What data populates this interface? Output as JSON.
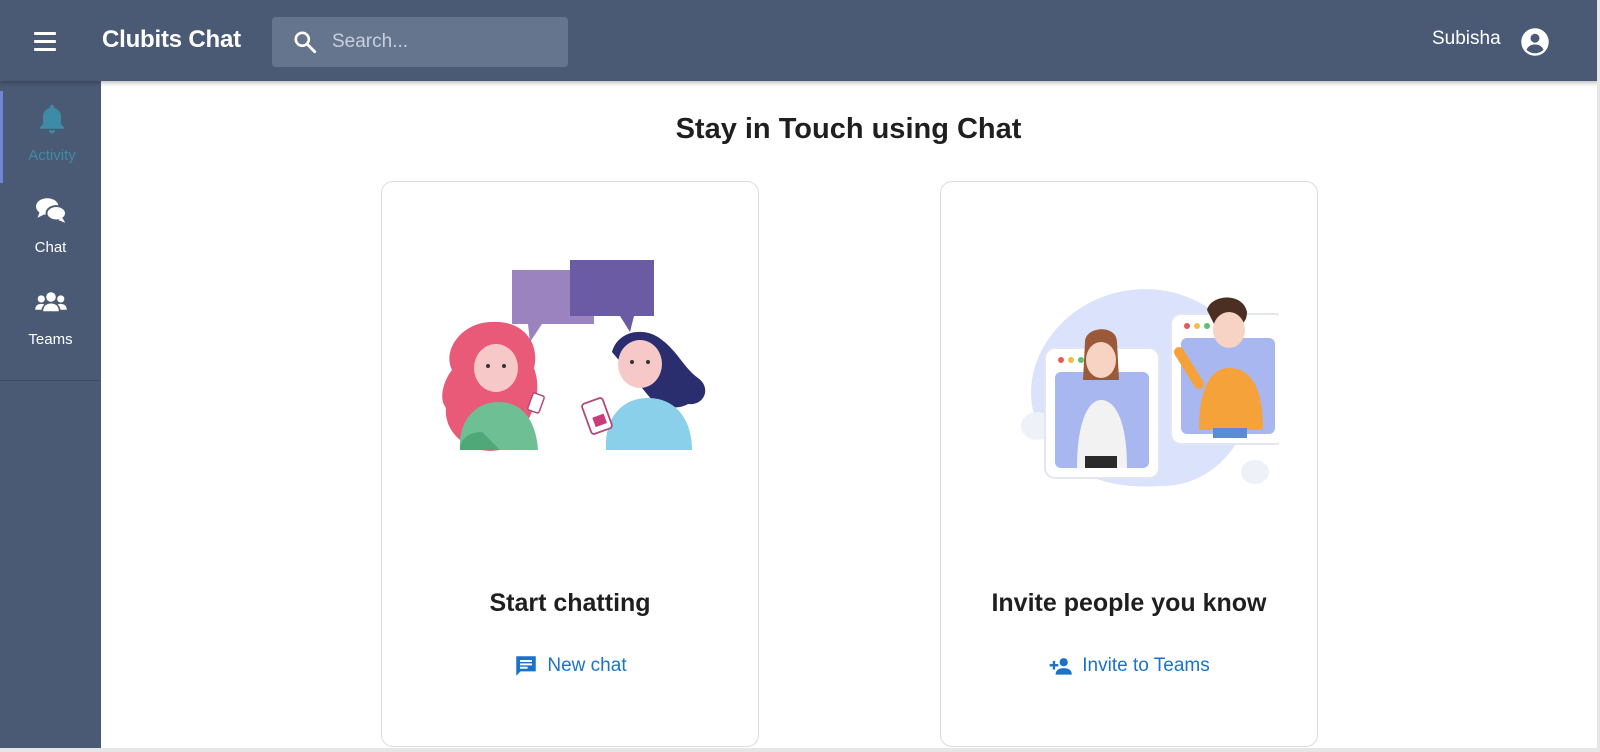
{
  "header": {
    "title": "Clubits Chat",
    "search_placeholder": "Search...",
    "search_value": "",
    "user_name": "Subisha"
  },
  "sidebar": {
    "items": [
      {
        "label": "Activity",
        "icon": "bell-icon",
        "active": true
      },
      {
        "label": "Chat",
        "icon": "chat-bubbles-icon",
        "active": false
      },
      {
        "label": "Teams",
        "icon": "people-group-icon",
        "active": false
      }
    ]
  },
  "main": {
    "title": "Stay in Touch using Chat",
    "cards": [
      {
        "title": "Start chatting",
        "action_label": "New chat",
        "action_icon": "message-icon",
        "illustration": "two-women-chatting-illustration"
      },
      {
        "title": "Invite people you know",
        "action_label": "Invite to Teams",
        "action_icon": "person-add-icon",
        "illustration": "video-call-illustration"
      }
    ]
  },
  "colors": {
    "appbar": "#4a5a75",
    "search_bg": "#65758e",
    "active_accent": "#3d8ba5",
    "link": "#1a73c8",
    "title_text": "#1f1f1f"
  }
}
